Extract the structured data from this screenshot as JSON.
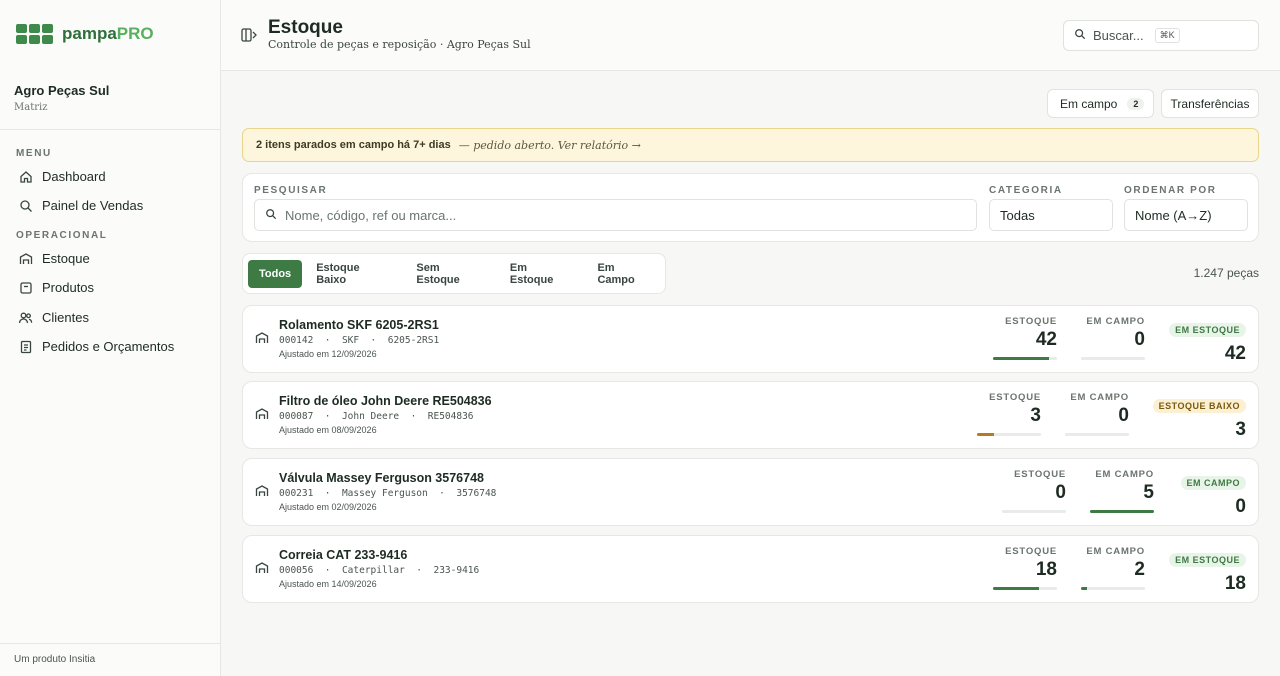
{
  "app": {
    "brand_part1": "pampa",
    "brand_part2": "PRO",
    "org_name": "Agro Peças Sul",
    "org_sub": "Matriz",
    "footer": "Um produto Insitia"
  },
  "sidebar": {
    "sections": [
      {
        "label": "Menu",
        "items": [
          {
            "label": "Dashboard",
            "icon": "home-icon"
          },
          {
            "label": "Painel de Vendas",
            "icon": "search-icon"
          }
        ]
      },
      {
        "label": "Operacional",
        "items": [
          {
            "label": "Estoque",
            "icon": "warehouse-icon"
          },
          {
            "label": "Produtos",
            "icon": "box-icon"
          },
          {
            "label": "Clientes",
            "icon": "users-icon"
          },
          {
            "label": "Pedidos e Orçamentos",
            "icon": "document-icon"
          }
        ]
      }
    ]
  },
  "header": {
    "title": "Estoque",
    "subtitle": "Controle de peças e reposição · Agro Peças Sul",
    "search_placeholder": "Buscar...",
    "search_shortcut": "⌘K"
  },
  "actions": {
    "em_campo_label": "Em campo",
    "em_campo_count": "2",
    "transferencias_label": "Transferências"
  },
  "alert": {
    "text": "2 itens parados em campo há 7+ dias",
    "link": "— pedido aberto. Ver relatório →"
  },
  "filters": {
    "search_label": "Pesquisar",
    "search_placeholder": "Nome, código, ref ou marca...",
    "category_label": "Categoria",
    "category_value": "Todas",
    "sort_label": "Ordenar por",
    "sort_value": "Nome (A→Z)"
  },
  "tabs": [
    "Todos",
    "Estoque Baixo",
    "Sem Estoque",
    "Em Estoque",
    "Em Campo"
  ],
  "total_count": "1.247 peças",
  "labels": {
    "estoque": "Estoque",
    "em_campo": "Em campo"
  },
  "colors": {
    "primary": "#3d7a44",
    "warning": "#b87a1a",
    "alert_bg": "#fdf6dd"
  },
  "products": [
    {
      "name": "Rolamento SKF 6205-2RS1",
      "code": "000142",
      "brand": "SKF",
      "ref": "6205-2RS1",
      "adjusted": "Ajustado em 12/09/2026",
      "estoque": "42",
      "em_campo": "0",
      "status_label": "Em estoque",
      "status_value": "42",
      "estoque_level": 0.88,
      "campo_level": 0.0
    },
    {
      "name": "Filtro de óleo John Deere RE504836",
      "code": "000087",
      "brand": "John Deere",
      "ref": "RE504836",
      "adjusted": "Ajustado em 08/09/2026",
      "estoque": "3",
      "em_campo": "0",
      "status_label": "Estoque baixo",
      "status_value": "3",
      "estoque_level": 0.27,
      "campo_level": 0.0
    },
    {
      "name": "Válvula Massey Ferguson 3576748",
      "code": "000231",
      "brand": "Massey Ferguson",
      "ref": "3576748",
      "adjusted": "Ajustado em 02/09/2026",
      "estoque": "0",
      "em_campo": "5",
      "status_label": "Em campo",
      "status_value": "0",
      "estoque_level": 0.0,
      "campo_level": 1.0
    },
    {
      "name": "Correia CAT 233-9416",
      "code": "000056",
      "brand": "Caterpillar",
      "ref": "233-9416",
      "adjusted": "Ajustado em 14/09/2026",
      "estoque": "18",
      "em_campo": "2",
      "status_label": "Em estoque",
      "status_value": "18",
      "estoque_level": 0.72,
      "campo_level": 0.1
    }
  ]
}
